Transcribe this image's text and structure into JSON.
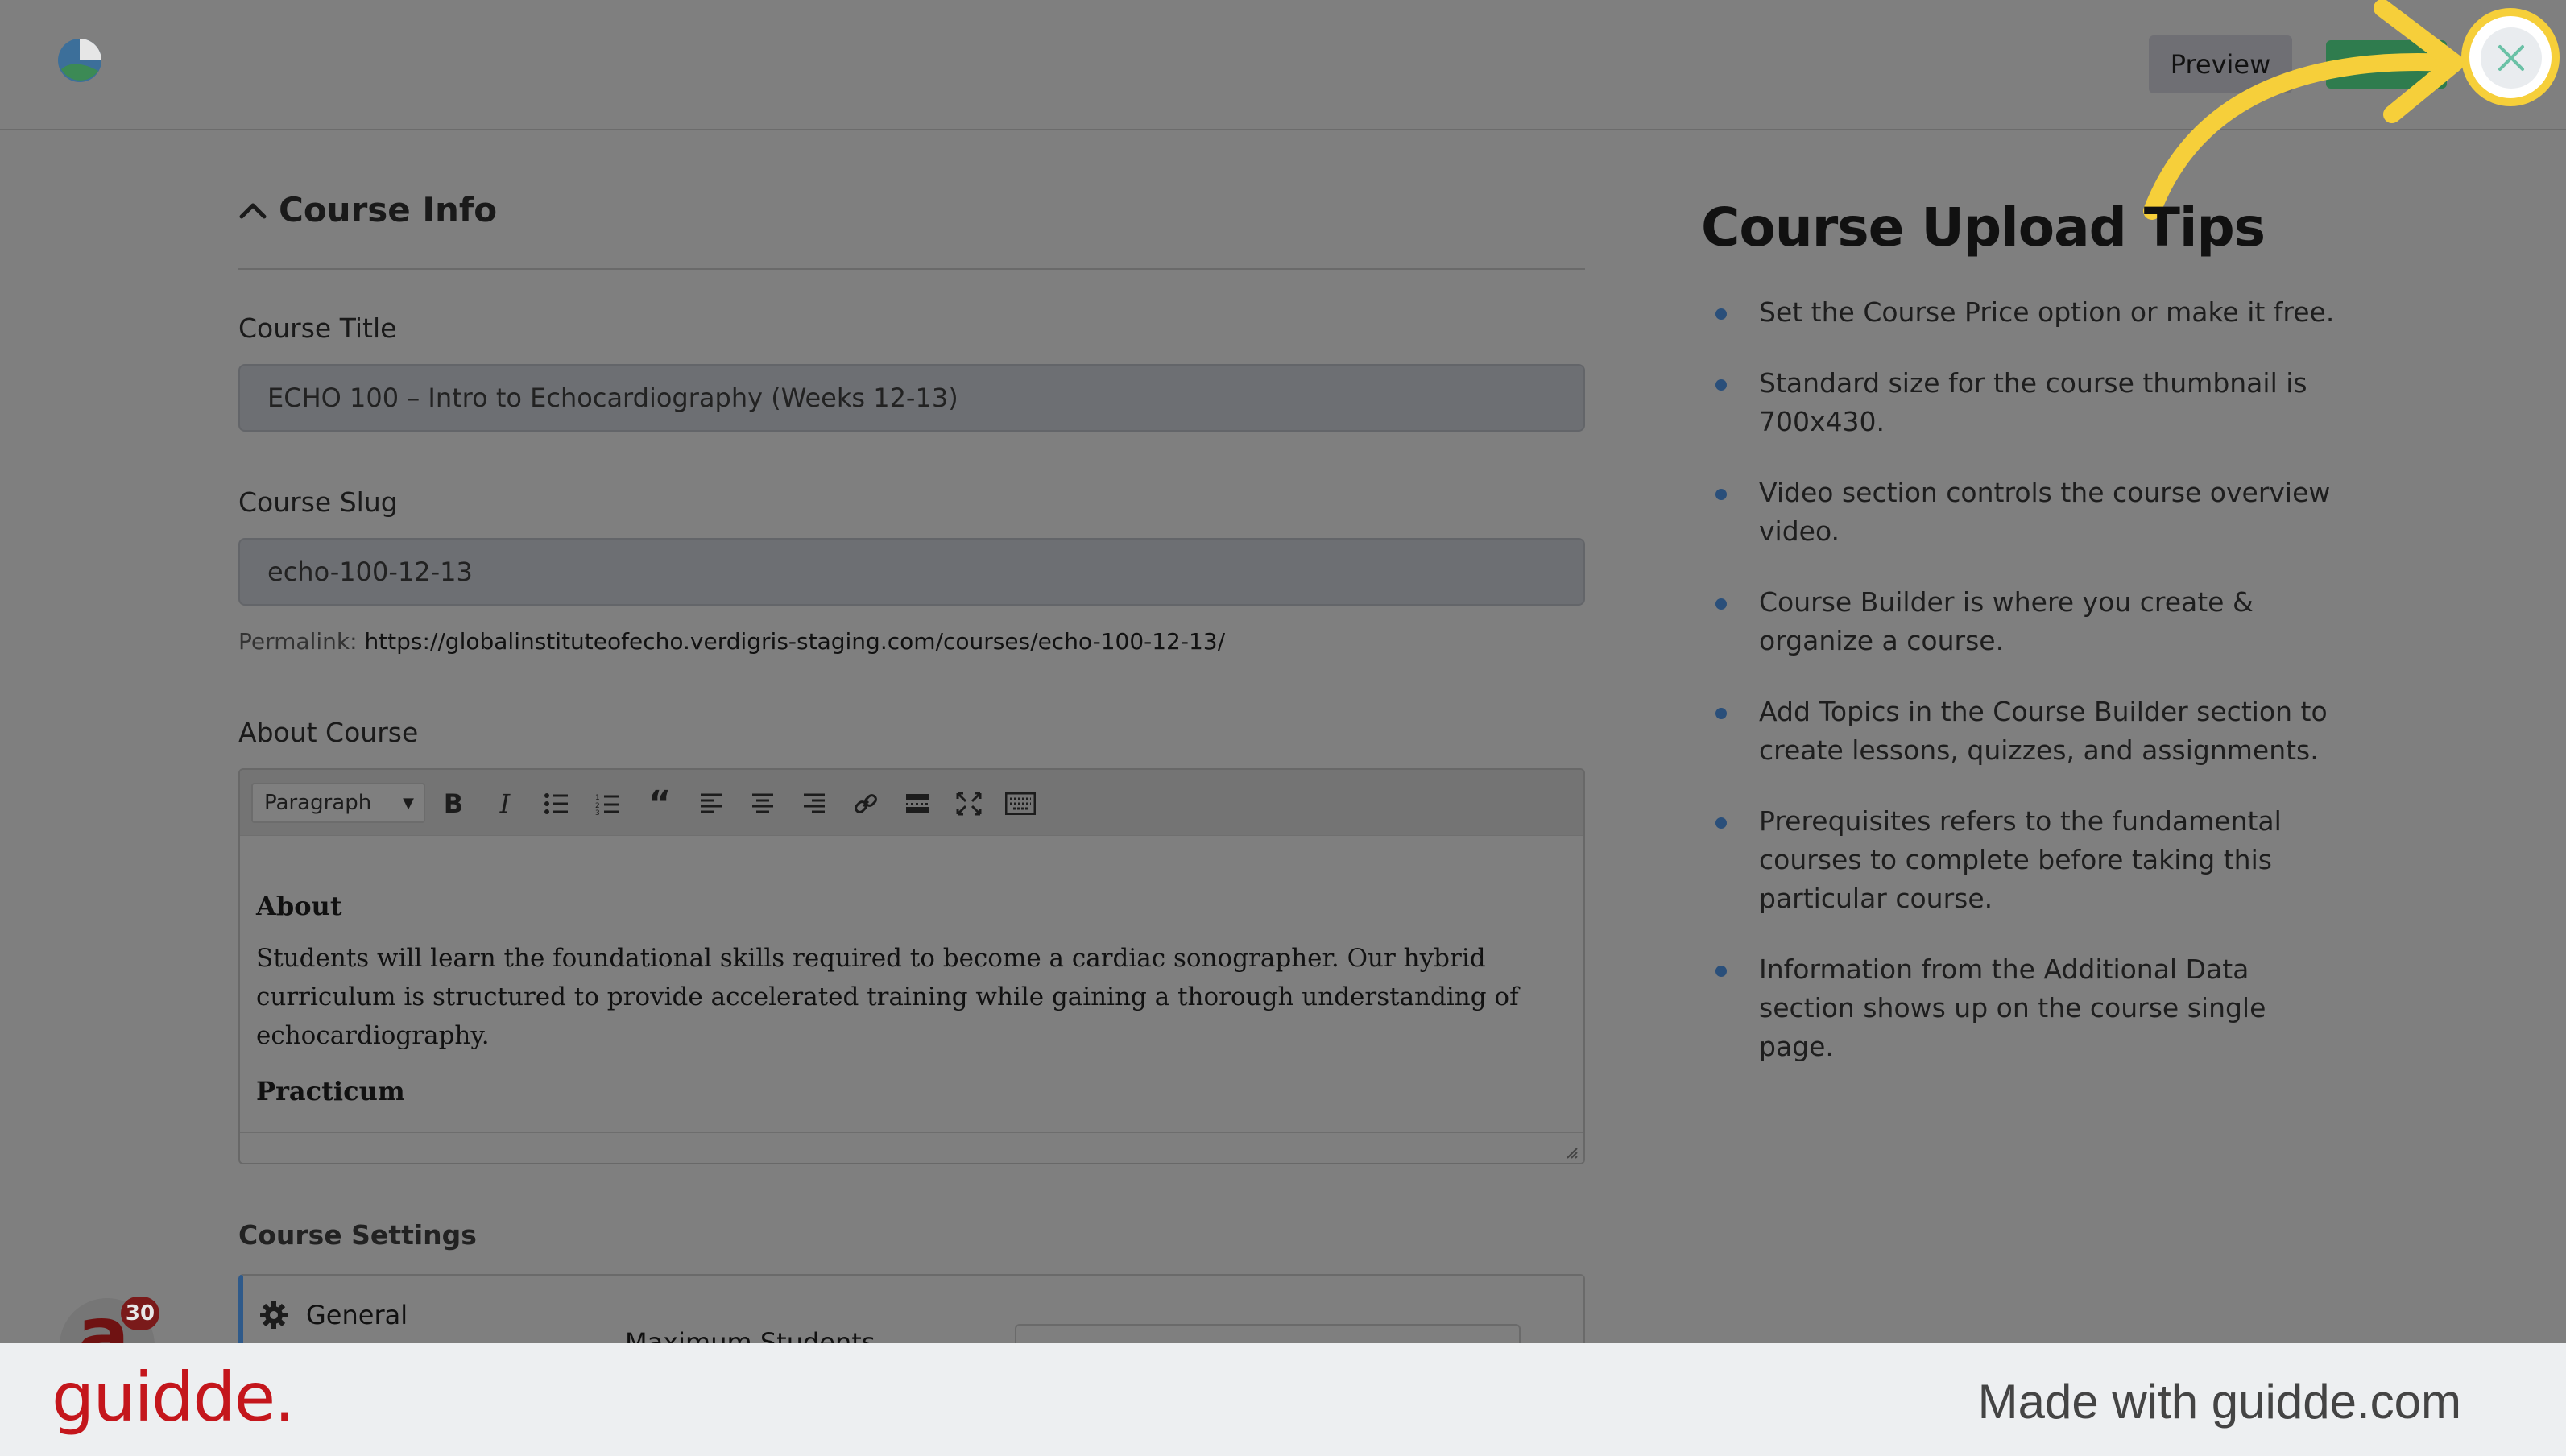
{
  "header": {
    "logo_icon": "globe-logo-icon",
    "preview_label": "Preview",
    "close_icon": "close-icon"
  },
  "course_info": {
    "section_title": "Course Info",
    "title_label": "Course Title",
    "title_value": "ECHO 100 – Intro to Echocardiography (Weeks 12-13)",
    "slug_label": "Course Slug",
    "slug_value": "echo-100-12-13",
    "permalink_label": "Permalink:",
    "permalink_url": "https://globalinstituteofecho.verdigris-staging.com/courses/echo-100-12-13/",
    "about_label": "About Course"
  },
  "editor": {
    "format_select": "Paragraph",
    "toolbar_icons": [
      "bold-icon",
      "italic-icon",
      "bullet-list-icon",
      "numbered-list-icon",
      "blockquote-icon",
      "align-left-icon",
      "align-center-icon",
      "align-right-icon",
      "link-icon",
      "read-more-icon",
      "fullscreen-icon",
      "keyboard-icon"
    ],
    "content": {
      "heading1": "About",
      "paragraph1": "Students will learn the foundational skills required to become a cardiac sonographer. Our  hybrid curriculum is structured  to provide accelerated training while gaining a thorough understanding of echocardiography.",
      "heading2": "Practicum"
    }
  },
  "settings": {
    "title": "Course Settings",
    "tab_general": "General",
    "max_students_label": "Maximum Students"
  },
  "chat": {
    "letter": "a",
    "badge_count": "30"
  },
  "tips": {
    "title": "Course Upload Tips",
    "items": [
      "Set the Course Price option or make it free.",
      "Standard size for the course thumbnail is 700x430.",
      "Video section controls the course overview video.",
      "Course Builder is where you create & organize a course.",
      "Add Topics in the Course Builder section to create lessons, quizzes, and assignments.",
      "Prerequisites refers to the fundamental courses to complete before taking this particular course.",
      "Information from the Additional Data section shows up on the course single page."
    ]
  },
  "footer": {
    "brand": "guidde.",
    "made_with": "Made with guidde.com"
  },
  "colors": {
    "highlight": "#f6cf3a",
    "brand_red": "#c4161c",
    "publish_green": "#2f7c4e"
  }
}
